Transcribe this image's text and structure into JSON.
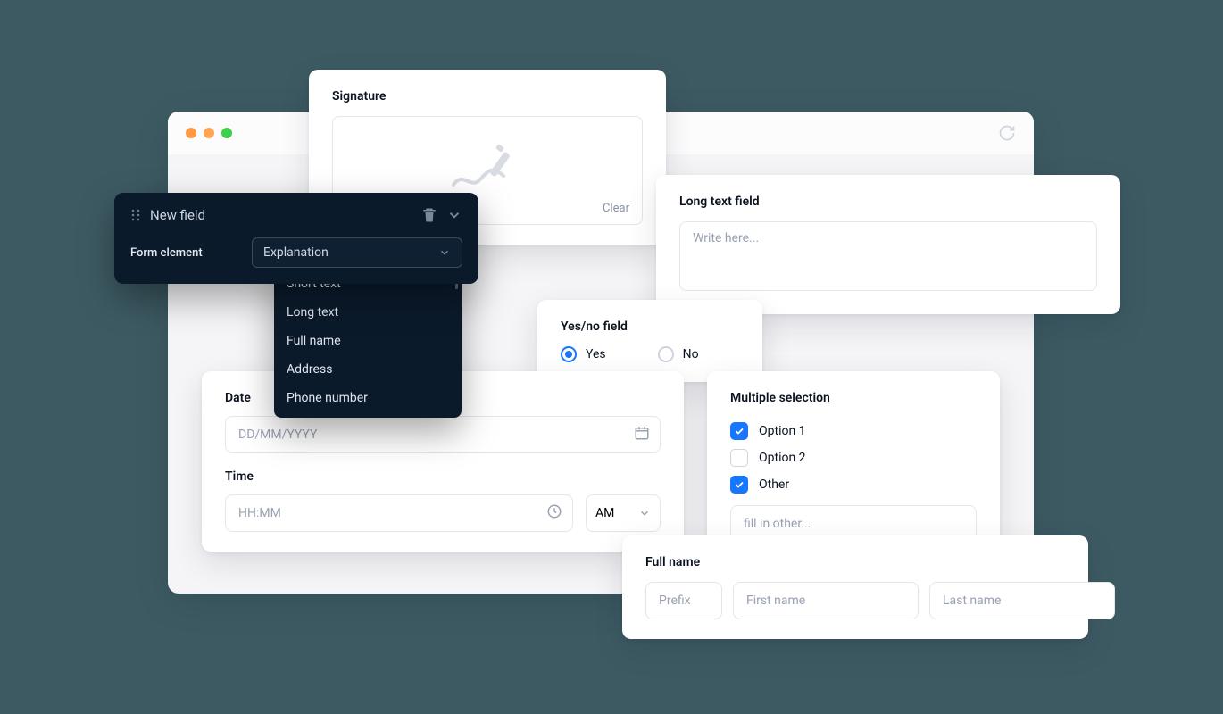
{
  "signature": {
    "title": "Signature",
    "clear": "Clear"
  },
  "newField": {
    "title": "New field",
    "label": "Form element",
    "selected": "Explanation",
    "options": [
      "Short text",
      "Long text",
      "Full name",
      "Address",
      "Phone number"
    ]
  },
  "longText": {
    "title": "Long text field",
    "placeholder": "Write here..."
  },
  "yesNo": {
    "title": "Yes/no field",
    "yes": "Yes",
    "no": "No"
  },
  "dateTime": {
    "dateLabel": "Date",
    "datePlaceholder": "DD/MM/YYYY",
    "timeLabel": "Time",
    "timePlaceholder": "HH:MM",
    "ampm": "AM"
  },
  "multi": {
    "title": "Multiple selection",
    "opt1": "Option 1",
    "opt2": "Option 2",
    "other": "Other",
    "otherPlaceholder": "fill in other..."
  },
  "fullName": {
    "title": "Full name",
    "prefix": "Prefix",
    "first": "First name",
    "last": "Last name"
  }
}
